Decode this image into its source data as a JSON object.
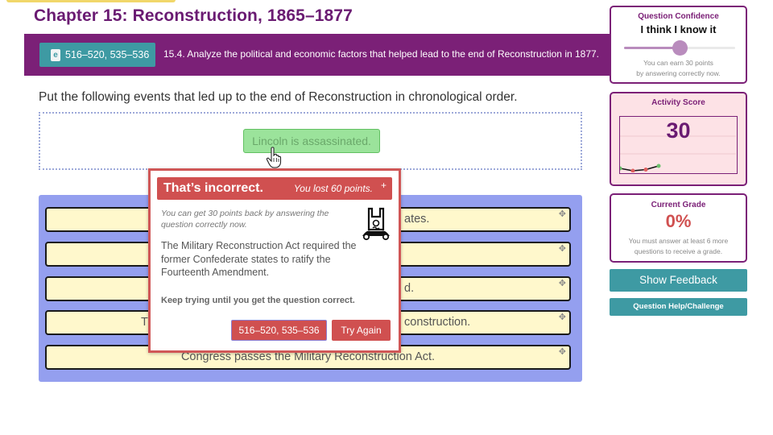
{
  "header": {
    "chapter_title": "Chapter 15: Reconstruction, 1865–1877"
  },
  "objective": {
    "ebook_pages": "516–520, 535–536",
    "ebook_icon": "book-icon",
    "text": "15.4. Analyze the political and economic factors that helped lead to the end of Reconstruction in 1877."
  },
  "question": {
    "prompt": "Put the following events that led up to the end of Reconstruction in chronological order.",
    "dragging_item": "Lincoln is assassinated.",
    "list_items": [
      {
        "visible_text": "ates."
      },
      {
        "visible_text": ""
      },
      {
        "visible_text": "d."
      },
      {
        "visible_text_left": "T",
        "visible_text": "construction."
      },
      {
        "visible_text": "Congress passes the Military Reconstruction Act."
      }
    ]
  },
  "feedback_modal": {
    "title": "That’s incorrect.",
    "points_lost": "You lost 60 points.",
    "close_icon": "+",
    "subtitle": "You can get 30 points back by answering the question correctly now.",
    "body": "The Military Reconstruction Act required the former Confederate states to ratify the Fourteenth Amendment.",
    "keep_trying": "Keep trying until you get the question correct.",
    "pages_button": "516–520, 535–536",
    "try_again_button": "Try Again"
  },
  "confidence": {
    "label": "Question Confidence",
    "value": "I think I know it",
    "slider_level": 0.5,
    "note_line1": "You can earn 30 points",
    "note_line2": "by answering correctly now."
  },
  "activity_score": {
    "label": "Activity Score",
    "value": "30",
    "history": [
      {
        "value": 0.1,
        "status": "correct",
        "color": "#6cc06c"
      },
      {
        "value": 0.0,
        "status": "incorrect",
        "color": "#e06060"
      },
      {
        "value": 0.05,
        "status": "incorrect",
        "color": "#e06060"
      },
      {
        "value": 0.2,
        "status": "correct",
        "color": "#6cc06c"
      }
    ]
  },
  "current_grade": {
    "label": "Current Grade",
    "value": "0%",
    "note_line1": "You must answer at least 6 more",
    "note_line2": "questions to receive a grade."
  },
  "buttons": {
    "show_feedback": "Show Feedback",
    "question_help": "Question Help/Challenge"
  },
  "colors": {
    "brand_purple": "#7b2077",
    "teal": "#3e9aa3",
    "error_red": "#d05050",
    "list_bg": "#949fef",
    "item_bg": "#fff8cc"
  }
}
